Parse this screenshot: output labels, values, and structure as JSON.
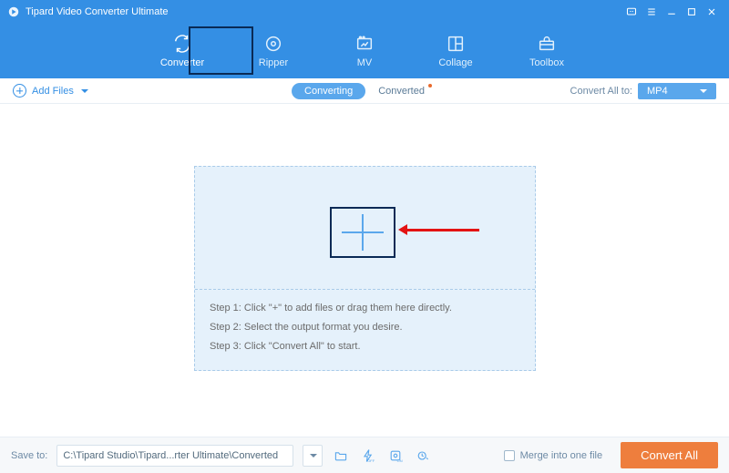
{
  "titlebar": {
    "title": "Tipard Video Converter Ultimate"
  },
  "tabs": [
    {
      "id": "converter",
      "label": "Converter",
      "active": true
    },
    {
      "id": "ripper",
      "label": "Ripper"
    },
    {
      "id": "mv",
      "label": "MV"
    },
    {
      "id": "collage",
      "label": "Collage"
    },
    {
      "id": "toolbox",
      "label": "Toolbox"
    }
  ],
  "toolbar": {
    "add_files_label": "Add Files",
    "converting_label": "Converting",
    "converted_label": "Converted",
    "convert_all_to_label": "Convert All to:",
    "output_format": "MP4"
  },
  "drop": {
    "step1": "Step 1: Click \"+\" to add files or drag them here directly.",
    "step2": "Step 2: Select the output format you desire.",
    "step3": "Step 3: Click \"Convert All\" to start."
  },
  "footer": {
    "save_to_label": "Save to:",
    "output_path": "C:\\Tipard Studio\\Tipard...rter Ultimate\\Converted",
    "merge_label": "Merge into one file",
    "convert_all_button": "Convert All"
  }
}
